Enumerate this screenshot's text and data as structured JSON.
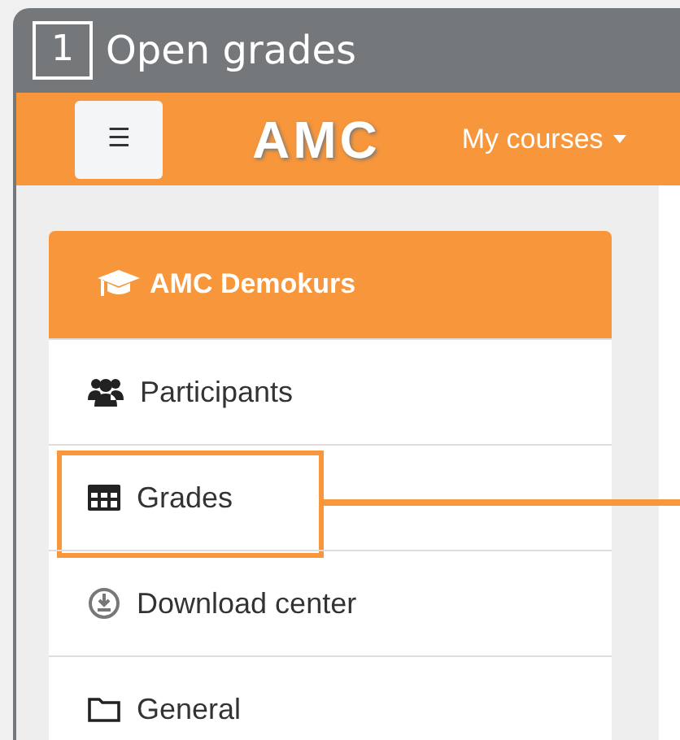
{
  "step": {
    "number": "1",
    "title": "Open grades"
  },
  "navbar": {
    "menu_glyph": "☰",
    "logo": "AMC",
    "menu_label": "My courses"
  },
  "course_menu": {
    "title": "AMC Demokurs",
    "items": [
      {
        "kind": "people",
        "label": "Participants",
        "highlighted": false
      },
      {
        "kind": "table",
        "label": "Grades",
        "highlighted": true
      },
      {
        "kind": "download",
        "label": "Download center",
        "highlighted": false
      },
      {
        "kind": "folder",
        "label": "General",
        "highlighted": false
      }
    ]
  }
}
